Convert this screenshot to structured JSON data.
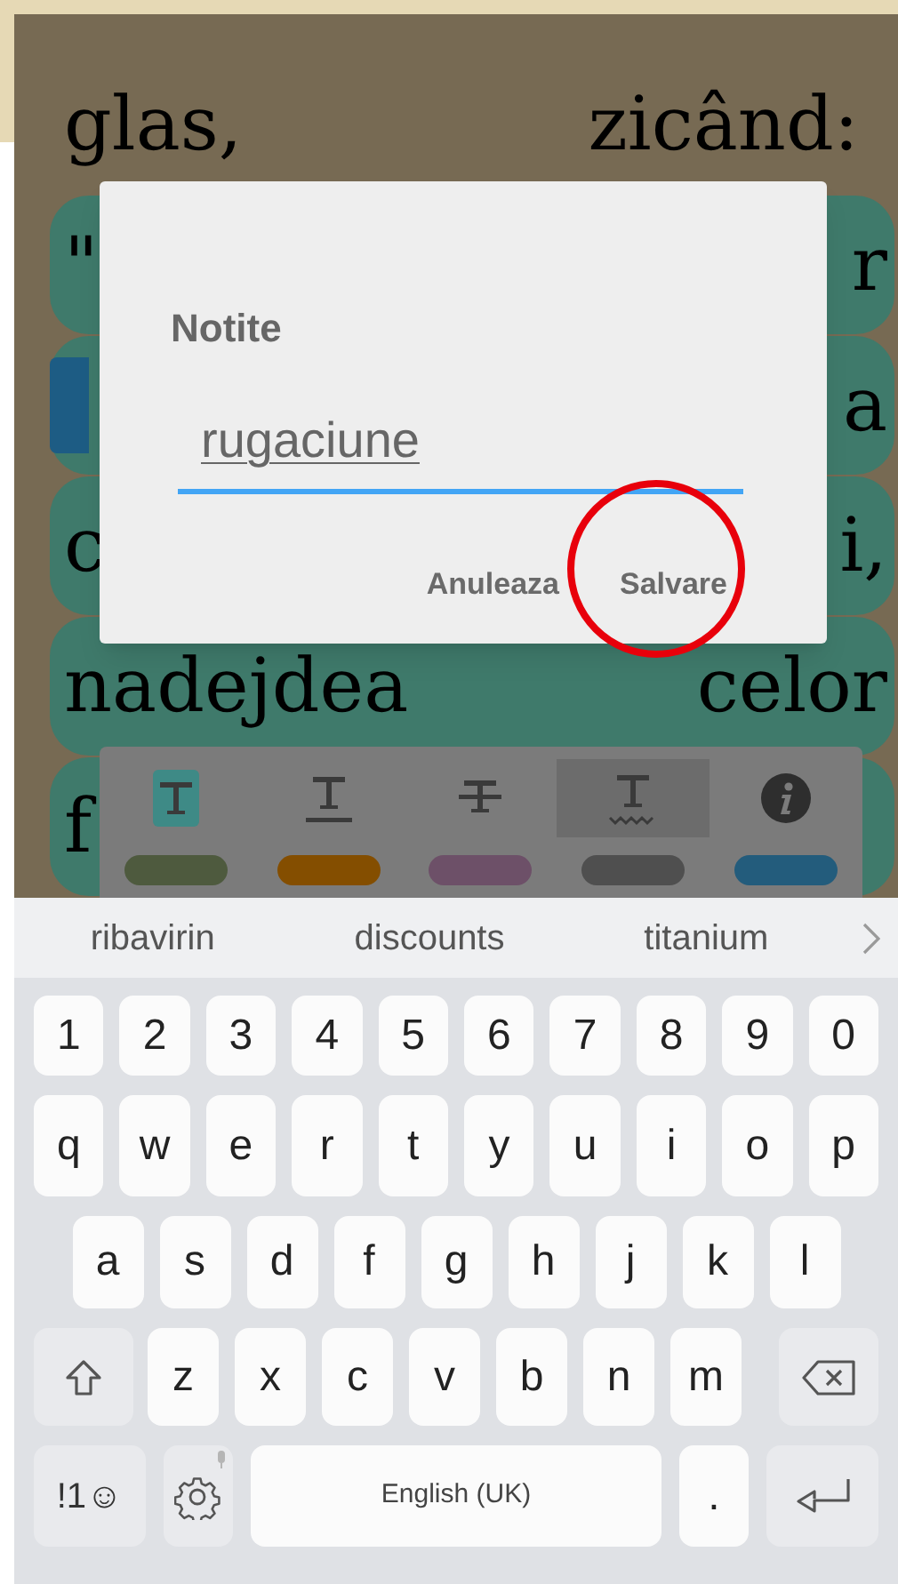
{
  "reader": {
    "lines": [
      {
        "left": "glas,",
        "right": "zicând:",
        "highlighted": false,
        "bookmarked": false
      },
      {
        "left": "\"",
        "right": "r",
        "highlighted": true,
        "bookmarked": false
      },
      {
        "right": "a",
        "highlighted": true,
        "bookmarked": true
      },
      {
        "left": "c",
        "right": "i,",
        "highlighted": true,
        "bookmarked": false
      },
      {
        "left": "nadejdea",
        "right": "celor",
        "highlighted": true,
        "bookmarked": false
      },
      {
        "left": "f",
        "highlighted": true,
        "bookmarked": false
      }
    ]
  },
  "dialog": {
    "title": "Notite",
    "field": {
      "value": "rugaciune"
    },
    "buttons": [
      "Anuleaza",
      "Salvare"
    ]
  },
  "toolbar": {
    "tools": [
      {
        "kind": "highlight",
        "selected": false
      },
      {
        "kind": "underline",
        "selected": false
      },
      {
        "kind": "strikethrough",
        "selected": false
      },
      {
        "kind": "squiggly",
        "selected": true
      },
      {
        "kind": "info",
        "selected": false
      }
    ],
    "colors": [
      {
        "color": "#4e5a3e"
      },
      {
        "color": "#844e00"
      },
      {
        "color": "#6d5068"
      },
      {
        "color": "#4f4f4f"
      },
      {
        "color": "#235c7c"
      }
    ]
  },
  "keyboard": {
    "suggestions": [
      "ribavirin",
      "discounts",
      "titanium"
    ],
    "rows": [
      {
        "keys": [
          {
            "kind": "char",
            "label": "1"
          },
          {
            "kind": "char",
            "label": "2"
          },
          {
            "kind": "char",
            "label": "3"
          },
          {
            "kind": "char",
            "label": "4"
          },
          {
            "kind": "char",
            "label": "5"
          },
          {
            "kind": "char",
            "label": "6"
          },
          {
            "kind": "char",
            "label": "7"
          },
          {
            "kind": "char",
            "label": "8"
          },
          {
            "kind": "char",
            "label": "9"
          },
          {
            "kind": "char",
            "label": "0"
          }
        ]
      },
      {
        "keys": [
          {
            "kind": "char",
            "label": "q"
          },
          {
            "kind": "char",
            "label": "w"
          },
          {
            "kind": "char",
            "label": "e"
          },
          {
            "kind": "char",
            "label": "r"
          },
          {
            "kind": "char",
            "label": "t"
          },
          {
            "kind": "char",
            "label": "y"
          },
          {
            "kind": "char",
            "label": "u"
          },
          {
            "kind": "char",
            "label": "i"
          },
          {
            "kind": "char",
            "label": "o"
          },
          {
            "kind": "char",
            "label": "p"
          }
        ]
      },
      {
        "keys": [
          {
            "kind": "char",
            "label": "a"
          },
          {
            "kind": "char",
            "label": "s"
          },
          {
            "kind": "char",
            "label": "d"
          },
          {
            "kind": "char",
            "label": "f"
          },
          {
            "kind": "char",
            "label": "g"
          },
          {
            "kind": "char",
            "label": "h"
          },
          {
            "kind": "char",
            "label": "j"
          },
          {
            "kind": "char",
            "label": "k"
          },
          {
            "kind": "char",
            "label": "l"
          }
        ]
      },
      {
        "keys": [
          {
            "kind": "shift"
          },
          {
            "kind": "char",
            "label": "z"
          },
          {
            "kind": "char",
            "label": "x"
          },
          {
            "kind": "char",
            "label": "c"
          },
          {
            "kind": "char",
            "label": "v"
          },
          {
            "kind": "char",
            "label": "b"
          },
          {
            "kind": "char",
            "label": "n"
          },
          {
            "kind": "char",
            "label": "m"
          },
          {
            "kind": "backspace"
          }
        ]
      },
      {
        "keys": [
          {
            "kind": "symbols",
            "label": "!1☺"
          },
          {
            "kind": "settings"
          },
          {
            "kind": "space",
            "label": "English (UK)"
          },
          {
            "kind": "char",
            "label": "."
          },
          {
            "kind": "enter"
          }
        ]
      }
    ]
  }
}
